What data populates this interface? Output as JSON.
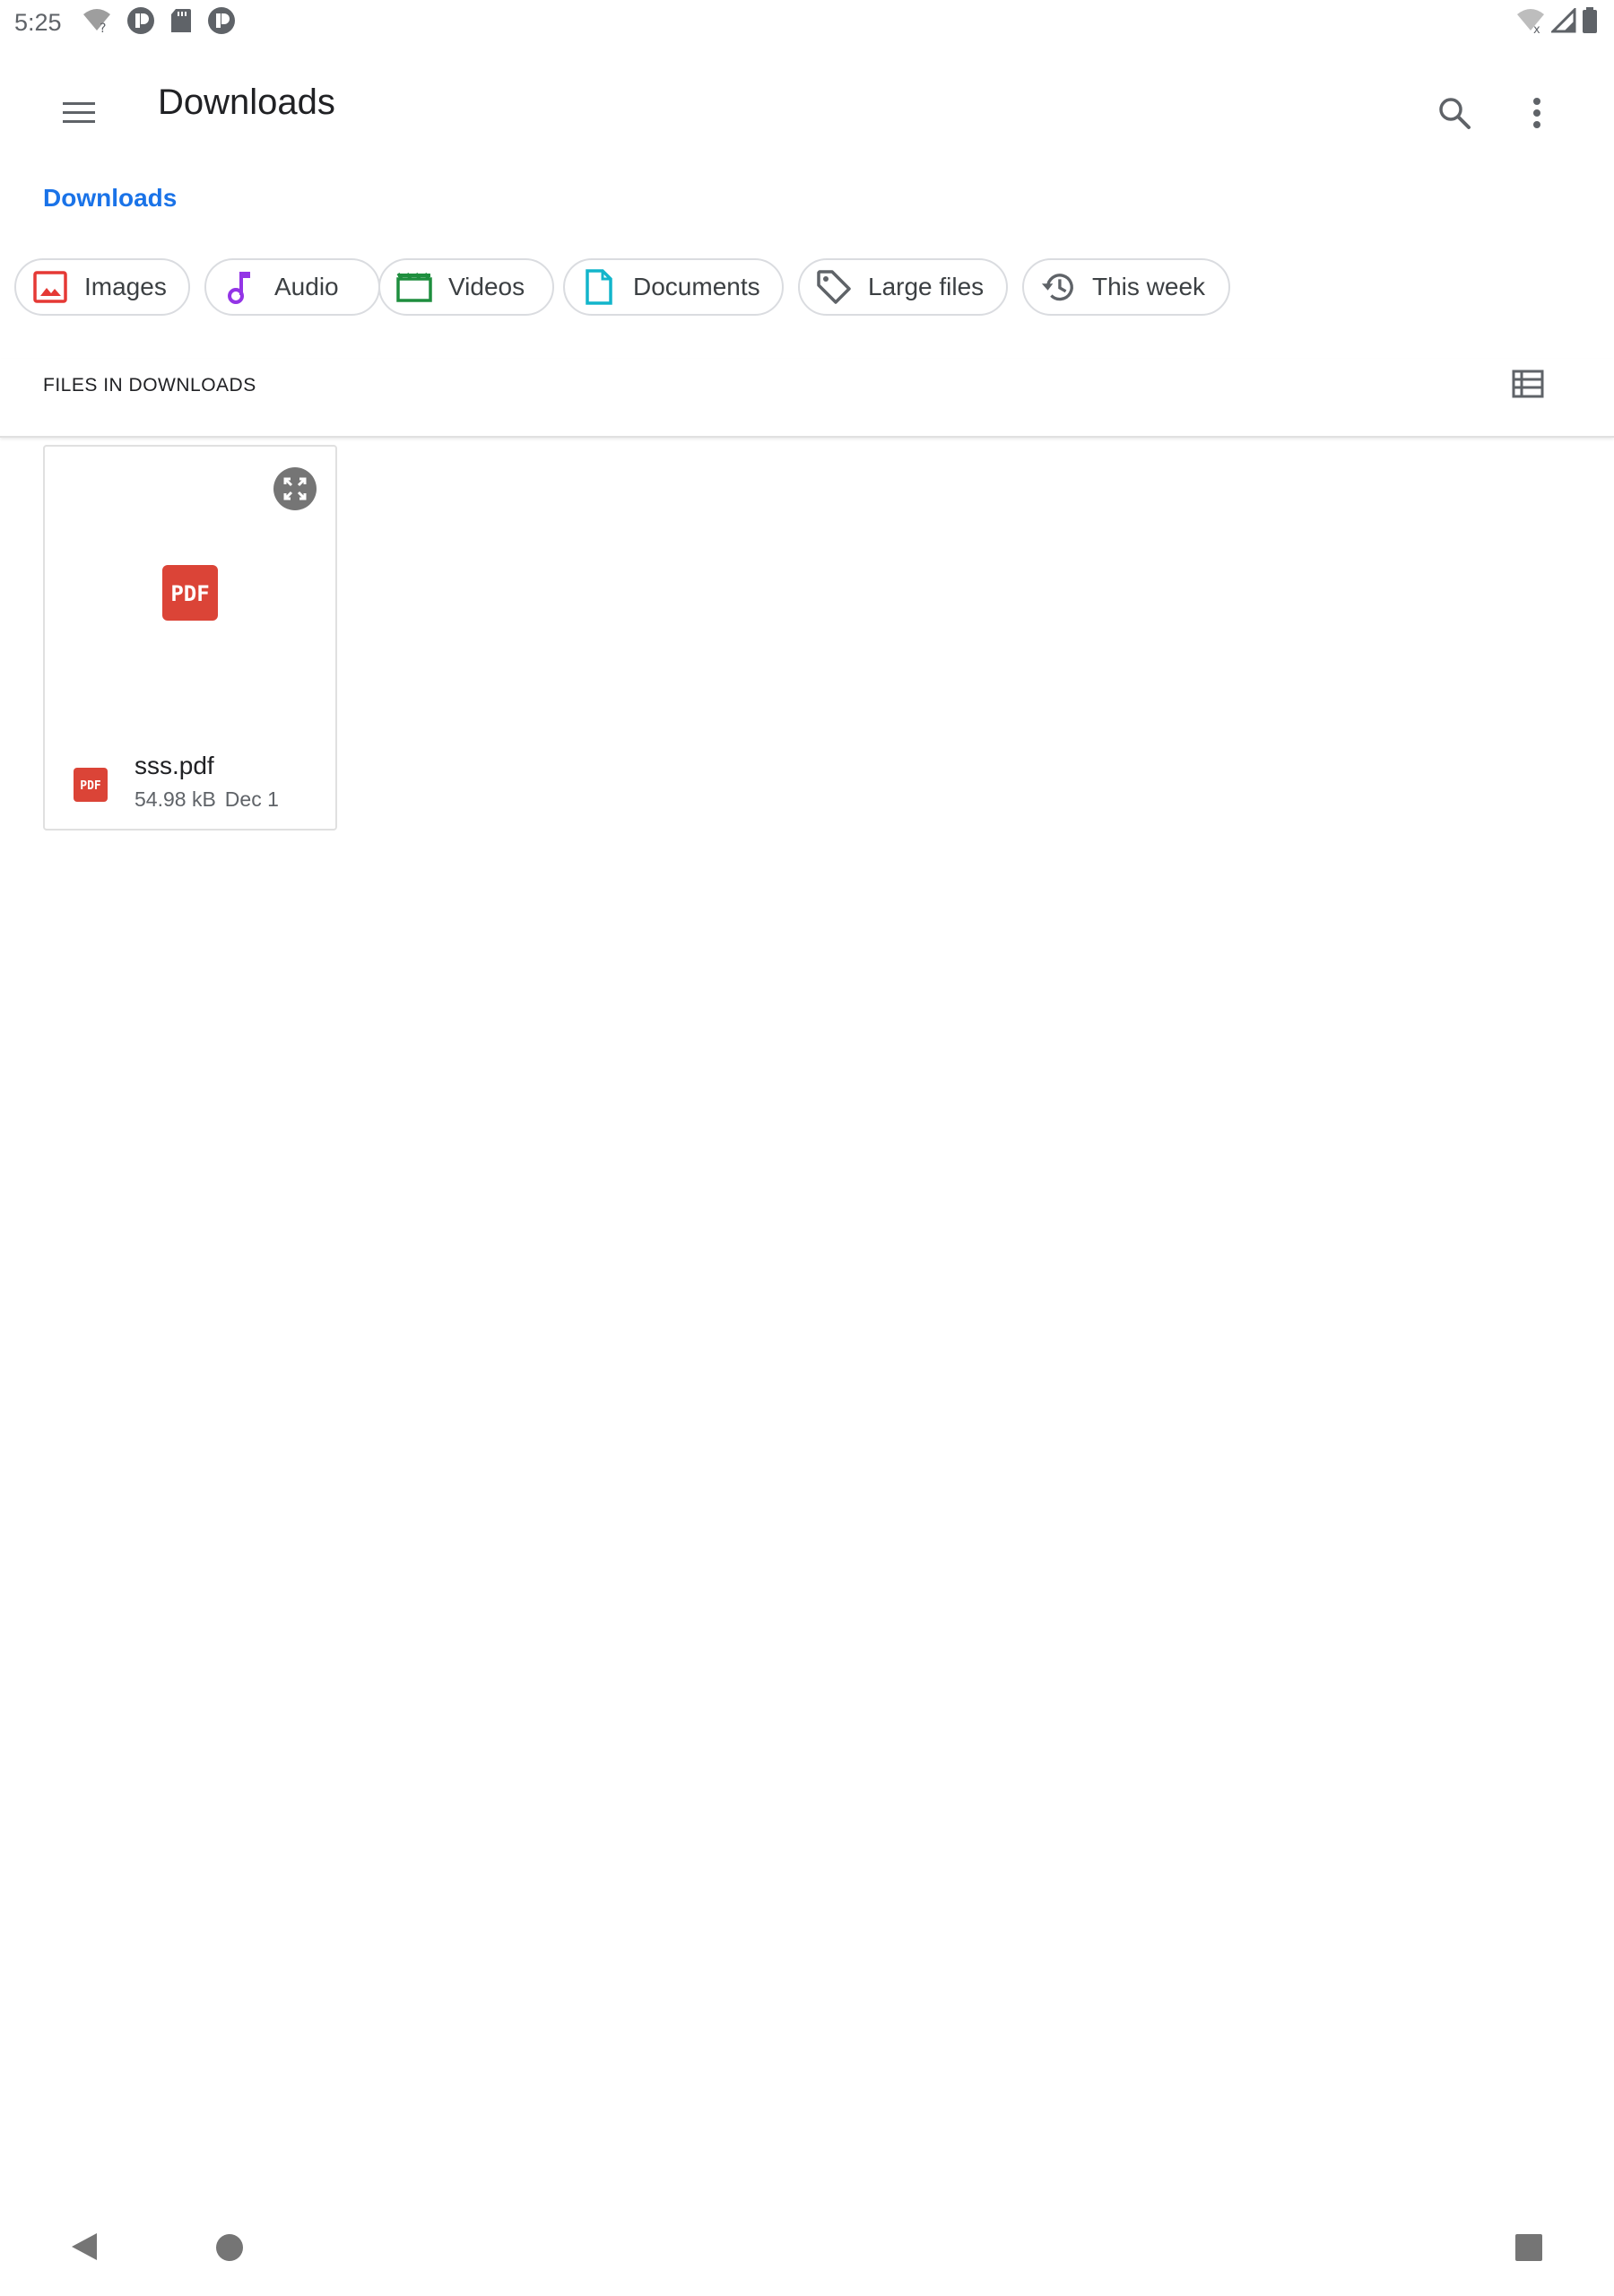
{
  "status_bar": {
    "time": "5:25",
    "left_icons": [
      "wifi-question-icon",
      "notification-app-icon",
      "sd-card-icon",
      "notification-app-icon"
    ],
    "right_icons": [
      "wifi-off-icon",
      "cell-signal-icon",
      "battery-icon"
    ]
  },
  "toolbar": {
    "title": "Downloads",
    "menu_icon": "hamburger-menu-icon",
    "search_icon": "search-icon",
    "more_icon": "more-vert-icon"
  },
  "breadcrumb": {
    "root": "Downloads"
  },
  "filter_chips": [
    {
      "label": "Images",
      "icon": "image-icon",
      "color": "#e53935"
    },
    {
      "label": "Audio",
      "icon": "music-note-icon",
      "color": "#9334e6"
    },
    {
      "label": "Videos",
      "icon": "movie-icon",
      "color": "#1e8e3e"
    },
    {
      "label": "Documents",
      "icon": "document-icon",
      "color": "#12b5cb"
    },
    {
      "label": "Large files",
      "icon": "label-tag-icon",
      "color": "#5f6368"
    },
    {
      "label": "This week",
      "icon": "history-icon",
      "color": "#5f6368"
    }
  ],
  "section": {
    "title": "FILES IN DOWNLOADS",
    "view_toggle_icon": "list-view-icon"
  },
  "files": [
    {
      "name": "sss.pdf",
      "size": "54.98 kB",
      "date": "Dec 1",
      "thumb_text": "PDF",
      "type_icon": "pdf-icon",
      "color": "#db4437"
    }
  ],
  "colors": {
    "accent": "#1a73e8",
    "pdf_red": "#db4437",
    "icon_gray": "#5f6368"
  }
}
